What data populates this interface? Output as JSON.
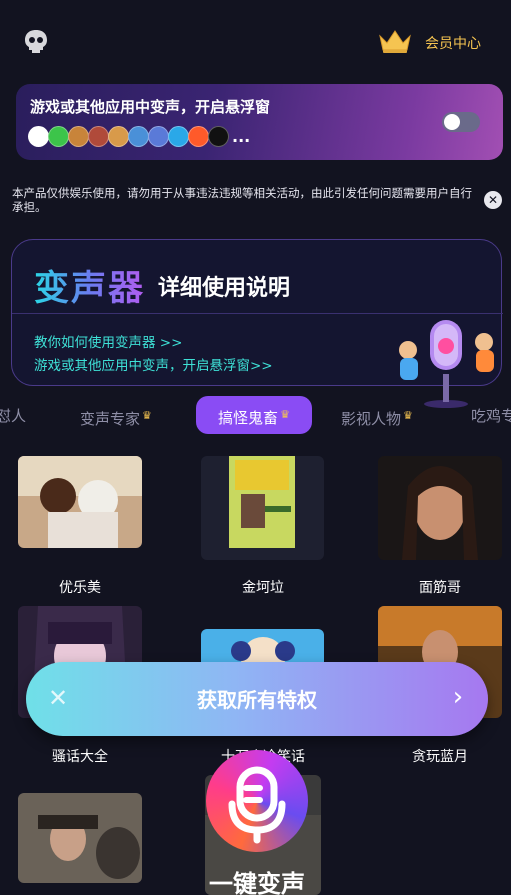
{
  "header": {
    "logo_icon": "skull-logo-icon",
    "vip_icon": "crown-icon",
    "vip_label": "会员中心"
  },
  "floating": {
    "title": "游戏或其他应用中变声，开启悬浮窗",
    "more": "...",
    "toggle_on": false,
    "apps": [
      {
        "name": "qq-icon",
        "color": "#ffffff"
      },
      {
        "name": "wechat-icon",
        "color": "#3cc44a"
      },
      {
        "name": "game-icon-1",
        "color": "#c8843a"
      },
      {
        "name": "game-icon-2",
        "color": "#b04a3a"
      },
      {
        "name": "game-icon-3",
        "color": "#d89a4a"
      },
      {
        "name": "game-icon-4",
        "color": "#4a90d8"
      },
      {
        "name": "game-icon-5",
        "color": "#5a7ad8"
      },
      {
        "name": "bilibili-icon",
        "color": "#2aa8e8"
      },
      {
        "name": "kuaishou-icon",
        "color": "#ff5a2a"
      },
      {
        "name": "tiktok-icon",
        "color": "#111111"
      }
    ]
  },
  "disclaimer": {
    "text": "本产品仅供娱乐使用，请勿用于从事违法违规等相关活动，由此引发任何问题需要用户自行承担。",
    "close": "✕"
  },
  "guide": {
    "brand": "变声器",
    "title": "详细使用说明",
    "link1": "教你如何使用变声器 >>",
    "link2": "游戏或其他应用中变声，开启悬浮窗>>"
  },
  "tabs": [
    {
      "label": "怼人",
      "crown": false
    },
    {
      "label": "变声专家",
      "crown": true
    },
    {
      "label": "搞怪鬼畜",
      "crown": true
    },
    {
      "label": "影视人物",
      "crown": true
    },
    {
      "label": "吃鸡专",
      "crown": false
    }
  ],
  "voices": [
    {
      "name": "优乐美"
    },
    {
      "name": "金坷垃"
    },
    {
      "name": "面筋哥"
    },
    {
      "name": "骚话大全"
    },
    {
      "name": "十万个冷笑话"
    },
    {
      "name": "贪玩蓝月"
    }
  ],
  "cta": {
    "label": "获取所有特权",
    "close": "✕",
    "arrow": "›"
  },
  "mic": {
    "label": "一键变声"
  },
  "colors": {
    "background": "#121320",
    "accent": "#8a4cf4",
    "gold": "#f5c451",
    "link": "#3ee0d6"
  }
}
